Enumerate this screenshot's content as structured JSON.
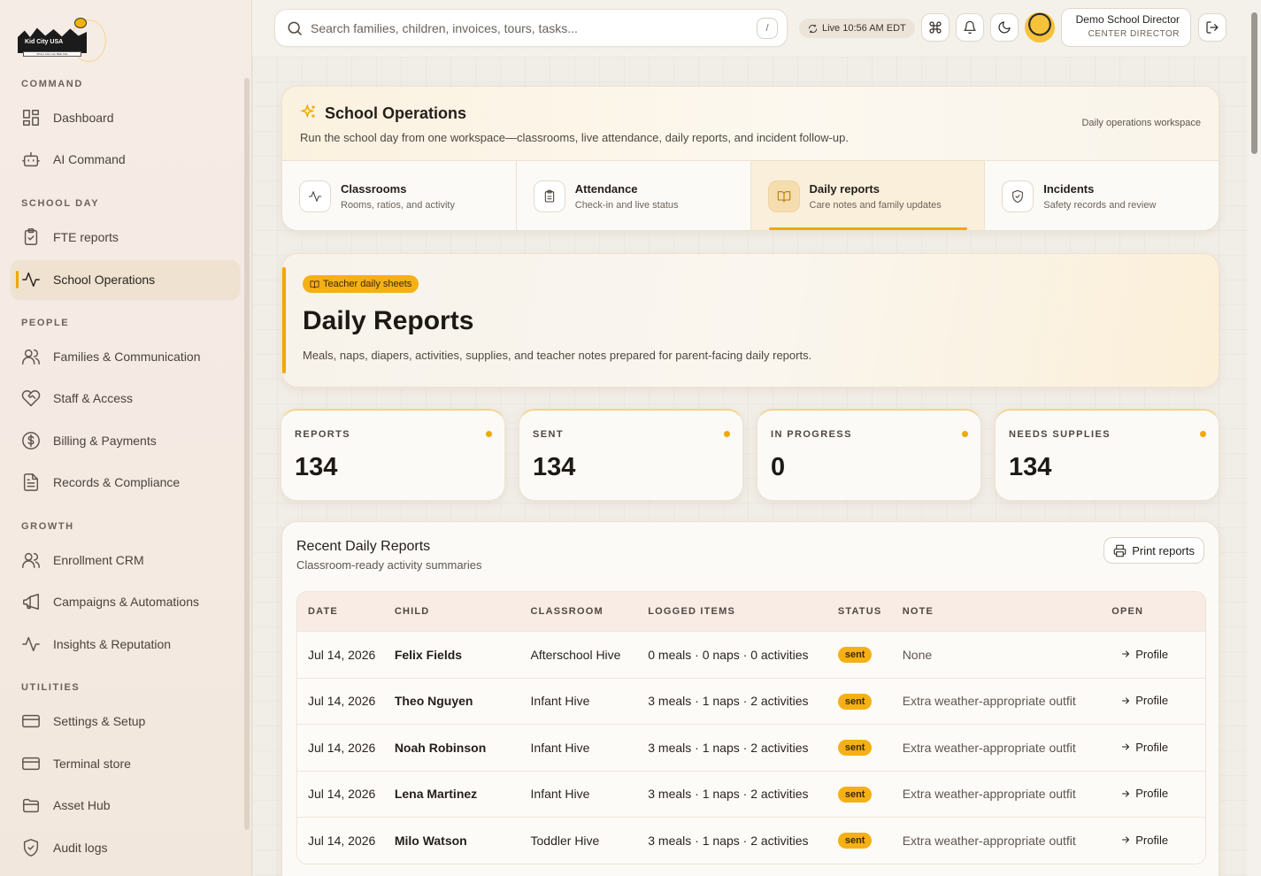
{
  "brand": {
    "logo_text": "Kid City USA",
    "logo_tagline": "Where Kids Can BEE Kids"
  },
  "sidebar": {
    "sections": [
      {
        "title": "COMMAND"
      },
      {
        "title": "SCHOOL DAY"
      },
      {
        "title": "PEOPLE"
      },
      {
        "title": "GROWTH"
      },
      {
        "title": "UTILITIES"
      }
    ],
    "items": [
      {
        "label": "Dashboard",
        "icon": "grid-icon"
      },
      {
        "label": "AI Command",
        "icon": "robot-icon"
      },
      {
        "label": "FTE reports",
        "icon": "clipboard-check-icon"
      },
      {
        "label": "School Operations",
        "icon": "activity-icon",
        "active": true
      },
      {
        "label": "Families & Communication",
        "icon": "users-icon"
      },
      {
        "label": "Staff & Access",
        "icon": "heart-handshake-icon"
      },
      {
        "label": "Billing & Payments",
        "icon": "dollar-circle-icon"
      },
      {
        "label": "Records & Compliance",
        "icon": "document-icon"
      },
      {
        "label": "Enrollment CRM",
        "icon": "users-icon"
      },
      {
        "label": "Campaigns & Automations",
        "icon": "megaphone-icon"
      },
      {
        "label": "Insights & Reputation",
        "icon": "activity-icon"
      },
      {
        "label": "Settings & Setup",
        "icon": "card-icon"
      },
      {
        "label": "Terminal store",
        "icon": "card-icon"
      },
      {
        "label": "Asset Hub",
        "icon": "folder-icon"
      },
      {
        "label": "Audit logs",
        "icon": "shield-icon"
      }
    ]
  },
  "topbar": {
    "search_placeholder": "Search families, children, invoices, tours, tasks...",
    "search_shortcut": "/",
    "live_label": "Live 10:56 AM EDT",
    "user_name": "Demo School Director",
    "user_role": "CENTER DIRECTOR"
  },
  "operations": {
    "title": "School Operations",
    "subtitle": "Run the school day from one workspace—classrooms, live attendance, daily reports, and incident follow-up.",
    "right_label": "Daily operations workspace",
    "tabs": [
      {
        "label": "Classrooms",
        "desc": "Rooms, ratios, and activity",
        "icon": "activity-icon"
      },
      {
        "label": "Attendance",
        "desc": "Check-in and live status",
        "icon": "clipboard-icon"
      },
      {
        "label": "Daily reports",
        "desc": "Care notes and family updates",
        "icon": "book-open-icon",
        "active": true
      },
      {
        "label": "Incidents",
        "desc": "Safety records and review",
        "icon": "shield-icon"
      }
    ]
  },
  "hero": {
    "badge": "Teacher daily sheets",
    "title": "Daily Reports",
    "subtitle": "Meals, naps, diapers, activities, supplies, and teacher notes prepared for parent-facing daily reports."
  },
  "stats": [
    {
      "label": "REPORTS",
      "value": "134"
    },
    {
      "label": "SENT",
      "value": "134"
    },
    {
      "label": "IN PROGRESS",
      "value": "0"
    },
    {
      "label": "NEEDS SUPPLIES",
      "value": "134"
    }
  ],
  "reports": {
    "title": "Recent Daily Reports",
    "subtitle": "Classroom-ready activity summaries",
    "print_label": "Print reports",
    "columns": [
      "DATE",
      "CHILD",
      "CLASSROOM",
      "LOGGED ITEMS",
      "STATUS",
      "NOTE",
      "OPEN"
    ],
    "rows": [
      {
        "date": "Jul 14, 2026",
        "child": "Felix Fields",
        "classroom": "Afterschool Hive",
        "logged": "0 meals · 0 naps · 0 activities",
        "status": "sent",
        "note": "None",
        "open": "Profile"
      },
      {
        "date": "Jul 14, 2026",
        "child": "Theo Nguyen",
        "classroom": "Infant Hive",
        "logged": "3 meals · 1 naps · 2 activities",
        "status": "sent",
        "note": "Extra weather-appropriate outfit",
        "open": "Profile"
      },
      {
        "date": "Jul 14, 2026",
        "child": "Noah Robinson",
        "classroom": "Infant Hive",
        "logged": "3 meals · 1 naps · 2 activities",
        "status": "sent",
        "note": "Extra weather-appropriate outfit",
        "open": "Profile"
      },
      {
        "date": "Jul 14, 2026",
        "child": "Lena Martinez",
        "classroom": "Infant Hive",
        "logged": "3 meals · 1 naps · 2 activities",
        "status": "sent",
        "note": "Extra weather-appropriate outfit",
        "open": "Profile"
      },
      {
        "date": "Jul 14, 2026",
        "child": "Milo Watson",
        "classroom": "Toddler Hive",
        "logged": "3 meals · 1 naps · 2 activities",
        "status": "sent",
        "note": "Extra weather-appropriate outfit",
        "open": "Profile"
      }
    ]
  },
  "colors": {
    "accent": "#f0a800",
    "badge": "#f5b015"
  }
}
